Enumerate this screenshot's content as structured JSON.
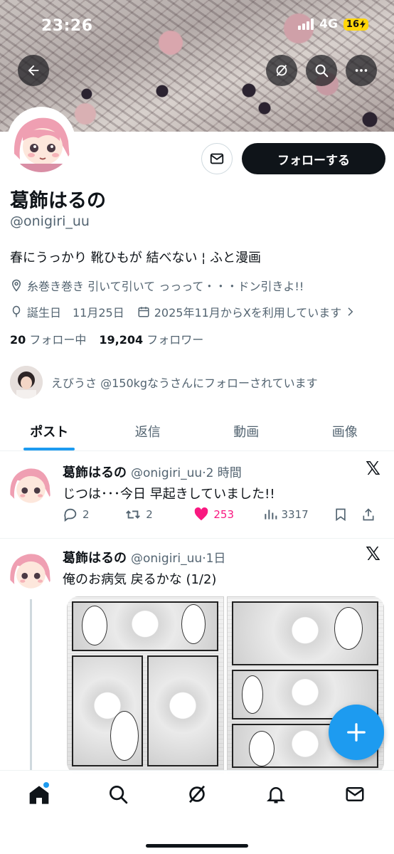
{
  "status_bar": {
    "time": "23:26",
    "network": "4G",
    "battery": "16"
  },
  "profile": {
    "name": "葛飾はるの",
    "handle": "@onigiri_uu",
    "bio": "春にうっかり 靴ひもが 結べない ¦ ふと漫画",
    "location": "糸巻き巻き 引いて引いて っっって・・・ドン引きよ!!",
    "birthday": "誕生日　11月25日",
    "joined": "2025年11月からXを利用しています",
    "follow_button": "フォローする",
    "following_count": "20",
    "following_label": "フォロー中",
    "followers_count": "19,204",
    "followers_label": "フォロワー",
    "followed_by": "えびうさ @150kgなうさんにフォローされています"
  },
  "tabs": [
    "ポスト",
    "返信",
    "動画",
    "画像"
  ],
  "posts": [
    {
      "name": "葛飾はるの",
      "handle": "@onigiri_uu",
      "time": "·2 時間",
      "text": "じつは･･･今日 早起きしていました!!",
      "replies": "2",
      "reposts": "2",
      "likes": "253",
      "views": "3317"
    },
    {
      "name": "葛飾はるの",
      "handle": "@onigiri_uu",
      "time": "·1日",
      "text": "俺のお病気 戻るかな (1/2)"
    }
  ],
  "colors": {
    "accent": "#1d9bf0",
    "like": "#f91880",
    "text": "#0f1419",
    "muted": "#536471"
  },
  "icons": [
    "back-arrow-icon",
    "grok-icon",
    "search-icon",
    "more-icon",
    "mail-icon",
    "location-icon",
    "balloon-icon",
    "calendar-icon",
    "x-logo-icon",
    "reply-icon",
    "repost-icon",
    "heart-icon",
    "views-icon",
    "bookmark-icon",
    "share-icon",
    "plus-icon",
    "home-icon",
    "notifications-icon",
    "messages-icon"
  ]
}
